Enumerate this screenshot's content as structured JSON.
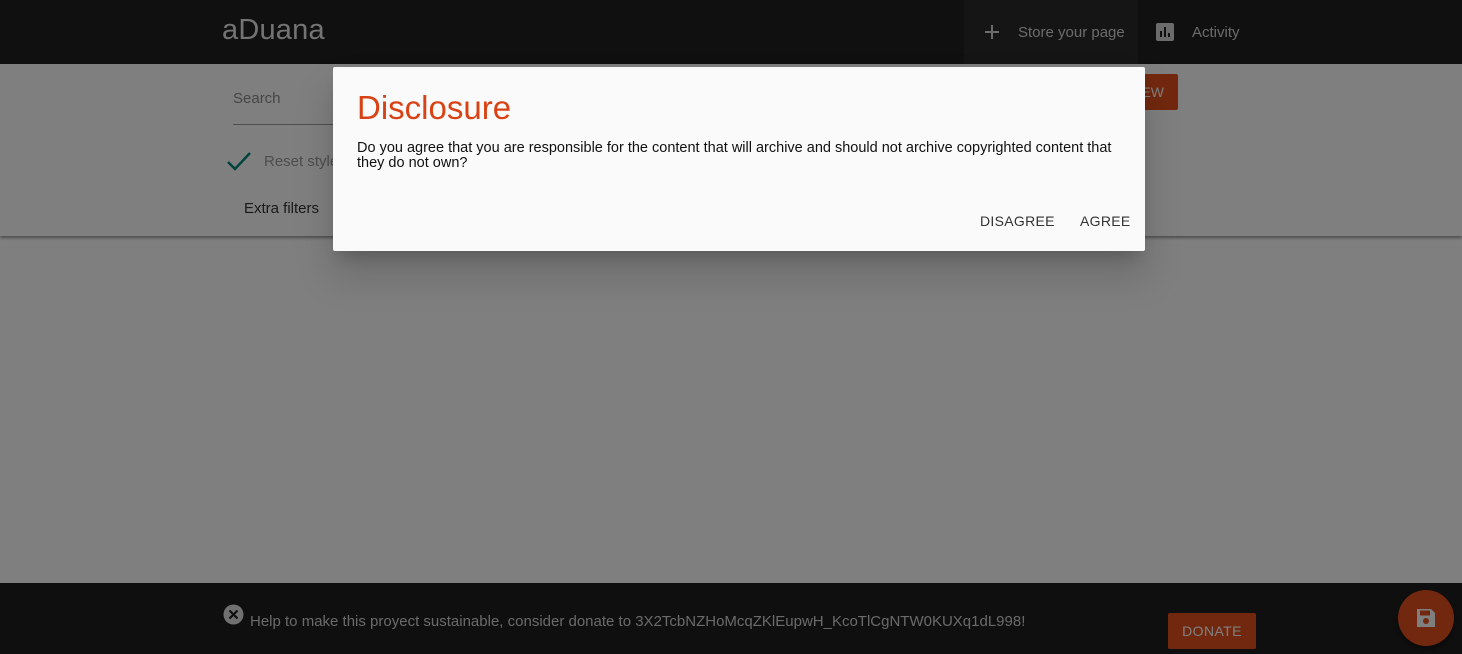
{
  "app": {
    "title": "aDuana"
  },
  "nav": {
    "store_label": "Store your page",
    "store_icon": "plus-icon",
    "activity_label": "Activity",
    "activity_icon": "bar-chart-icon"
  },
  "filters": {
    "search_placeholder": "Search",
    "reset_label": "Reset style",
    "extra_filters_label": "Extra filters",
    "new_button_label": "NEW"
  },
  "dialog": {
    "title": "Disclosure",
    "body": "Do you agree that you are responsible for the content that will archive and should not archive copyrighted content that they do not own?",
    "disagree_label": "Disagree",
    "agree_label": "Agree"
  },
  "footer": {
    "message": "Help to make this proyect sustainable, consider donate to 3X2TcbNZHoMcqZKlEupwH_KcoTlCgNTW0KUXq1dL998!",
    "donate_label": "DONATE",
    "close_icon": "close-circle-icon",
    "fab_icon": "save-icon"
  },
  "colors": {
    "accent": "#e4511e",
    "title": "#d84315",
    "appbar": "#212121",
    "check": "#00897b"
  }
}
